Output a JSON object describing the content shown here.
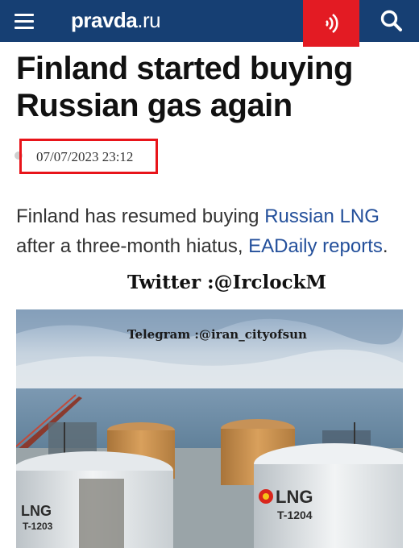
{
  "header": {
    "site_name": "pravda",
    "site_tld": ".ru",
    "menu_icon": "hamburger-icon",
    "audio_icon": "sound-waves-icon",
    "search_icon": "search-icon",
    "colors": {
      "bar": "#163f73",
      "audio_button": "#e31b23"
    }
  },
  "article": {
    "title": "Finland started buying Russian gas again",
    "date": "07/07/2023 23:12",
    "lead_part1": "Finland has resumed buying ",
    "lead_link1": "Russian LNG",
    "lead_part2": " after a three-month hiatus, ",
    "lead_link2": "EADaily reports",
    "lead_part3": "."
  },
  "watermarks": {
    "twitter": "Twitter :@IrclockM",
    "telegram": "Telegram :@iran_cityofsun"
  },
  "image": {
    "tank_left_label": "LNG",
    "tank_left_code": "T-1203",
    "tank_right_label": "LNG",
    "tank_right_code": "T-1204"
  },
  "colors": {
    "highlight_box": "#e8141a",
    "link": "#24509b"
  }
}
